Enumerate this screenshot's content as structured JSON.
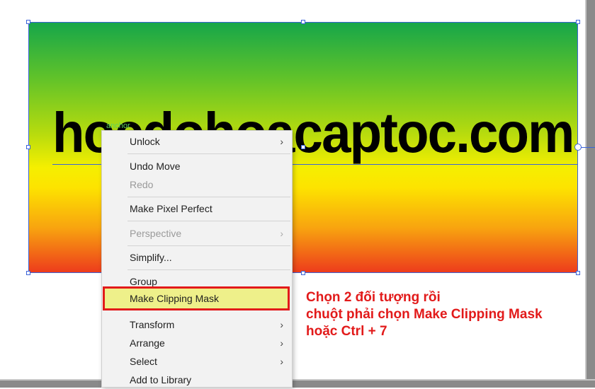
{
  "artwork": {
    "headline": "hocdohoacaptoc.com",
    "anchor_label": "anchor",
    "gradient_colors": [
      "#15a64a",
      "#b9dc0d",
      "#f5ef00",
      "#f8a40f",
      "#ed3a1c"
    ],
    "selection_color": "#3b63d9"
  },
  "context_menu": {
    "items": [
      {
        "label": "Unlock",
        "submenu": true,
        "disabled": false
      },
      {
        "label": "Undo Move",
        "submenu": false,
        "disabled": false
      },
      {
        "label": "Redo",
        "submenu": false,
        "disabled": true
      },
      {
        "label": "Make Pixel Perfect",
        "submenu": false,
        "disabled": false
      },
      {
        "label": "Perspective",
        "submenu": true,
        "disabled": true
      },
      {
        "label": "Simplify...",
        "submenu": false,
        "disabled": false
      },
      {
        "label": "Group",
        "submenu": false,
        "disabled": false
      },
      {
        "label": "Make Clipping Mask",
        "submenu": false,
        "disabled": false,
        "highlighted": true
      },
      {
        "label": "Transform",
        "submenu": true,
        "disabled": false
      },
      {
        "label": "Arrange",
        "submenu": true,
        "disabled": false
      },
      {
        "label": "Select",
        "submenu": true,
        "disabled": false
      },
      {
        "label": "Add to Library",
        "submenu": false,
        "disabled": false
      }
    ],
    "submenu_arrow": "›"
  },
  "annotation": {
    "line1": "Chọn 2 đối tượng rồi",
    "line2": "chuột phải chọn Make Clipping Mask",
    "line3": "hoặc Ctrl + 7",
    "color": "#e21a1a"
  }
}
